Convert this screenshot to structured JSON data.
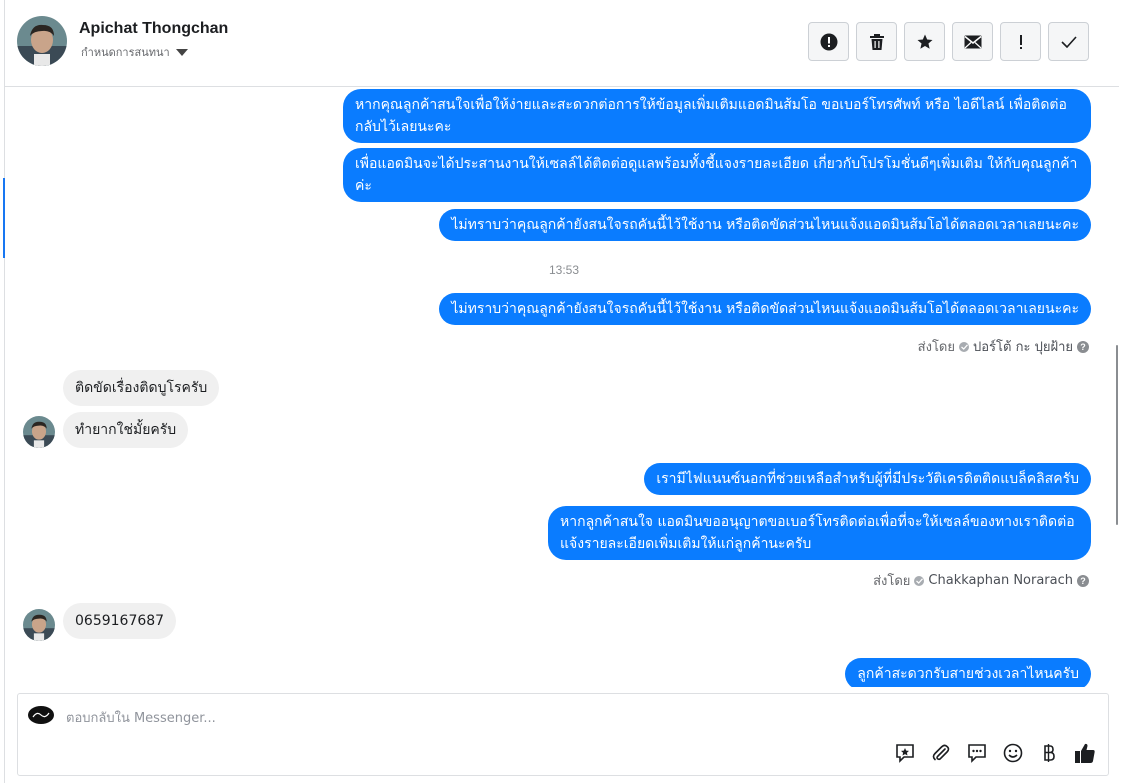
{
  "header": {
    "contact_name": "Apichat Thongchan",
    "assign_label": "กำหนดการสนทนา",
    "toolbar": {
      "report": "report-icon",
      "delete": "trash-icon",
      "star": "star-icon",
      "mail": "envelope-icon",
      "important": "exclamation-icon",
      "done": "checkmark-icon"
    }
  },
  "messages": [
    {
      "from": "page",
      "text": "หากคุณลูกค้าสนใจเพื่อให้ง่ายและสะดวกต่อการให้ข้อมูลเพิ่มเติมแอดมินส้มโอ ขอเบอร์โทรศัพท์ หรือ ไอดีไลน์ เพื่อติดต่อกลับไว้เลยนะคะ"
    },
    {
      "from": "page",
      "text": "เพื่อแอดมินจะได้ประสานงานให้เซลล์ได้ติดต่อดูแลพร้อมทั้งชี้แจงรายละเอียด เกี่ยวกับโปรโมชั่นดีๆเพิ่มเติม ให้กับคุณลูกค้าค่ะ"
    },
    {
      "from": "page",
      "text": "ไม่ทราบว่าคุณลูกค้ายังสนใจรถคันนี้ไว้ใช้งาน หรือติดขัดส่วนไหนแจ้งแอดมินส้มโอได้ตลอดเวลาเลยนะคะ"
    },
    {
      "from": "page",
      "text": "ไม่ทราบว่าคุณลูกค้ายังสนใจรถคันนี้ไว้ใช้งาน หรือติดขัดส่วนไหนแจ้งแอดมินส้มโอได้ตลอดเวลาเลยนะคะ"
    },
    {
      "from": "customer",
      "text": "ติดขัดเรื่องติดบูโรครับ"
    },
    {
      "from": "customer",
      "text": "ทำยากใช่มั้ยครับ"
    },
    {
      "from": "page",
      "text": "เรามีไฟแนนซ์นอกที่ช่วยเหลือสำหรับผู้ที่มีประวัติเครดิตติดแบล็คลิสครับ"
    },
    {
      "from": "page",
      "text": "หากลูกค้าสนใจ แอดมินขออนุญาตขอเบอร์โทรติดต่อเพื่อที่จะให้เซลล์ของทางเราติดต่อแจ้งรายละเอียดเพิ่มเติมให้แก่ลูกค้านะครับ"
    },
    {
      "from": "customer",
      "text": "0659167687"
    },
    {
      "from": "page",
      "text": "ลูกค้าสะดวกรับสายช่วงเวลาไหนครับ"
    }
  ],
  "timestamp": "13:53",
  "sent_by_prefix": "ส่งโดย",
  "sent_by": [
    "ปอร์โต้ กะ ปุยฝ้าย",
    "Chakkaphan Norarach"
  ],
  "composer": {
    "placeholder": "ตอบกลับใน Messenger...",
    "tools": [
      "saved-reply-icon",
      "attachment-icon",
      "message-icon",
      "emoji-icon",
      "baht-icon",
      "like-icon"
    ]
  },
  "colors": {
    "outgoing": "#0a7cff",
    "incoming": "#f0f0f0",
    "accent": "#1877f2"
  }
}
